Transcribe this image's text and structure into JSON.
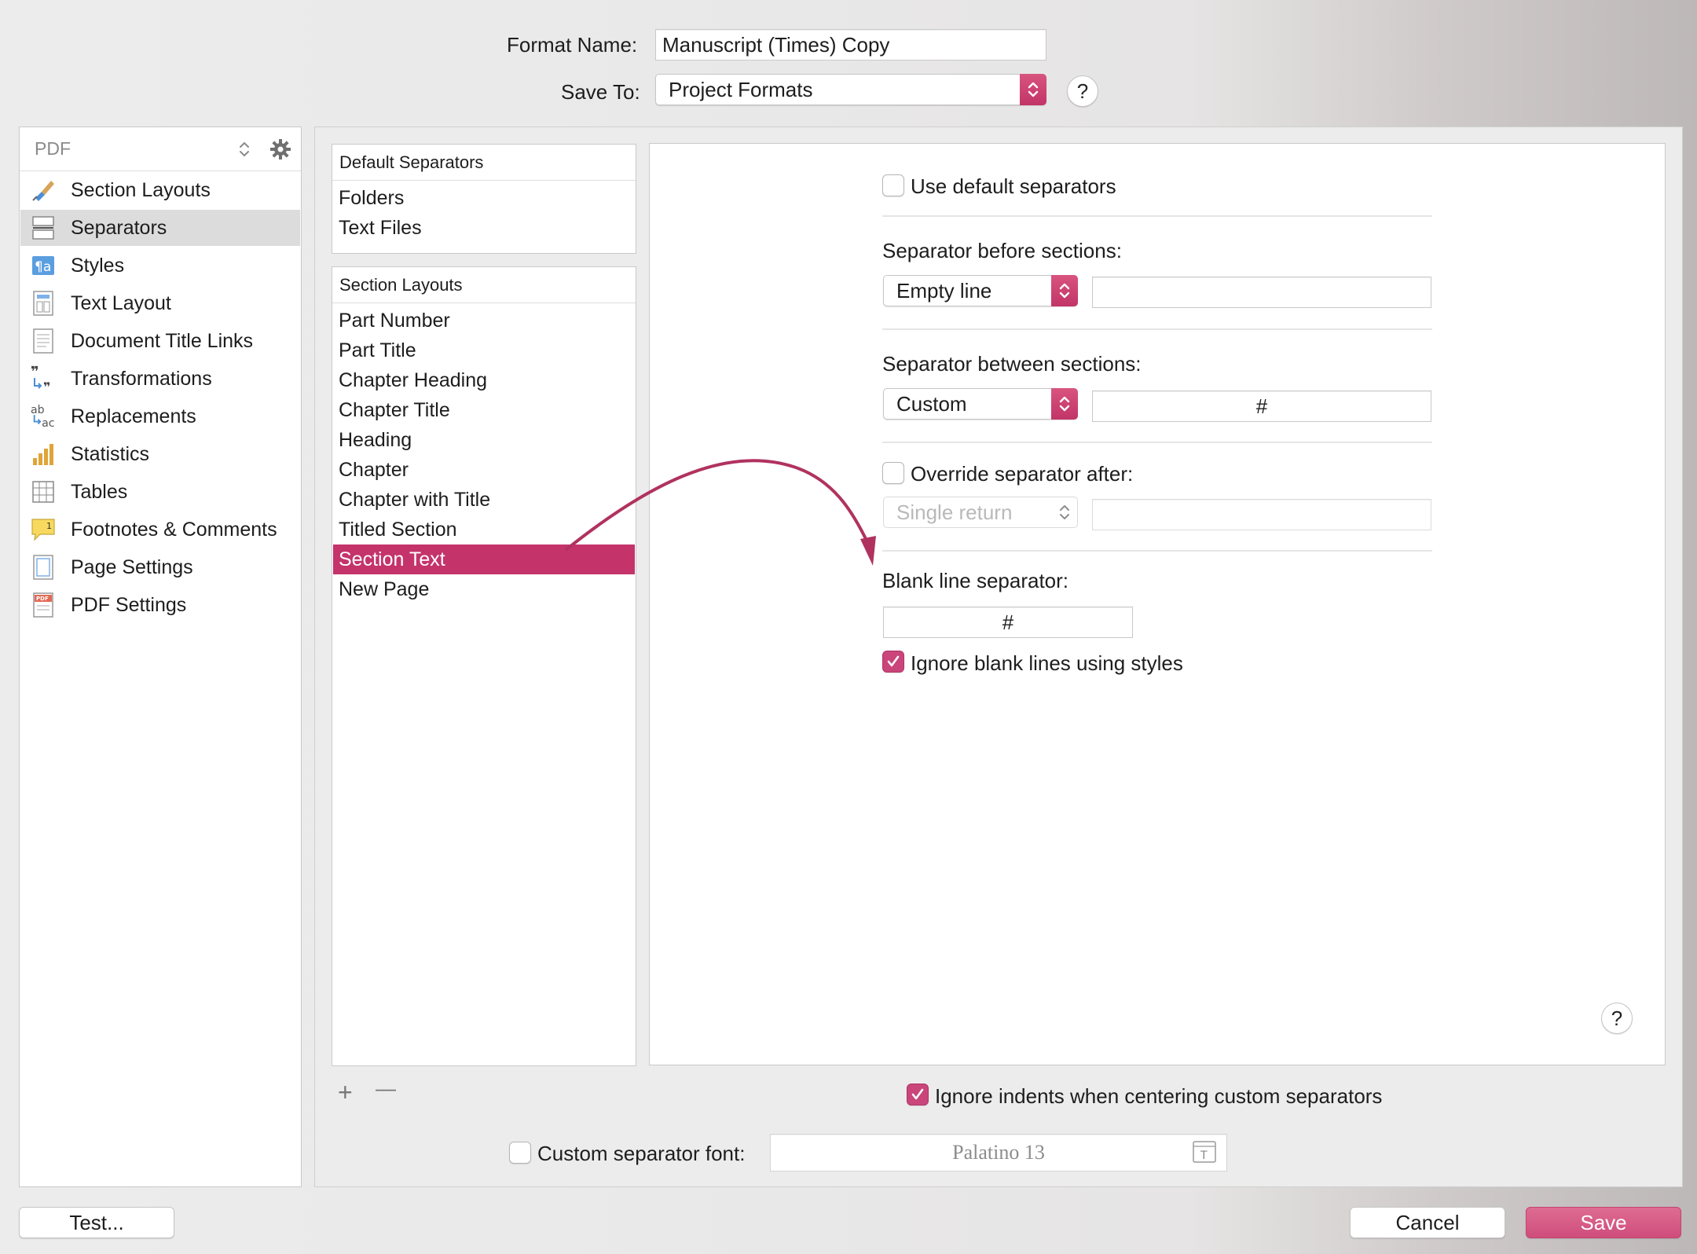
{
  "header": {
    "format_name_label": "Format Name:",
    "format_name_value": "Manuscript (Times) Copy",
    "save_to_label": "Save To:",
    "save_to_value": "Project Formats",
    "help_label": "?"
  },
  "sidebar": {
    "selector_value": "PDF",
    "items": [
      {
        "label": "Section Layouts",
        "icon": "brush-icon"
      },
      {
        "label": "Separators",
        "icon": "separator-icon"
      },
      {
        "label": "Styles",
        "icon": "paragraph-style-icon"
      },
      {
        "label": "Text Layout",
        "icon": "text-layout-icon"
      },
      {
        "label": "Document Title Links",
        "icon": "document-icon"
      },
      {
        "label": "Transformations",
        "icon": "quotes-transform-icon"
      },
      {
        "label": "Replacements",
        "icon": "replace-ab-icon"
      },
      {
        "label": "Statistics",
        "icon": "bar-chart-icon"
      },
      {
        "label": "Tables",
        "icon": "table-icon"
      },
      {
        "label": "Footnotes & Comments",
        "icon": "footnote-icon"
      },
      {
        "label": "Page Settings",
        "icon": "page-settings-icon"
      },
      {
        "label": "PDF Settings",
        "icon": "pdf-icon"
      }
    ],
    "selected_index": 1
  },
  "lists": {
    "default_header": "Default Separators",
    "default_items": [
      "Folders",
      "Text Files"
    ],
    "layouts_header": "Section Layouts",
    "layouts_items": [
      "Part Number",
      "Part Title",
      "Chapter Heading",
      "Chapter Title",
      "Heading",
      "Chapter",
      "Chapter with Title",
      "Titled Section",
      "Section Text",
      "New Page"
    ],
    "selected_layout": "Section Text",
    "add_label": "+",
    "remove_label": "—"
  },
  "settings": {
    "use_default_label": "Use default separators",
    "use_default_checked": false,
    "before_label": "Separator before sections:",
    "before_value": "Empty line",
    "before_text": "",
    "between_label": "Separator between sections:",
    "between_value": "Custom",
    "between_text": "#",
    "override_label": "Override separator after:",
    "override_checked": false,
    "override_value": "Single return",
    "override_text": "",
    "blank_label": "Blank line separator:",
    "blank_text": "#",
    "ignore_blank_label": "Ignore blank lines using styles",
    "ignore_blank_checked": true,
    "help_label": "?"
  },
  "bottom": {
    "ignore_indents_label": "Ignore indents when centering custom separators",
    "ignore_indents_checked": true,
    "custom_font_label": "Custom separator font:",
    "custom_font_checked": false,
    "custom_font_value": "Palatino 13"
  },
  "footer": {
    "test_label": "Test...",
    "cancel_label": "Cancel",
    "save_label": "Save"
  },
  "colors": {
    "accent": "#c4336a",
    "annotation_arrow": "#b0325f"
  }
}
